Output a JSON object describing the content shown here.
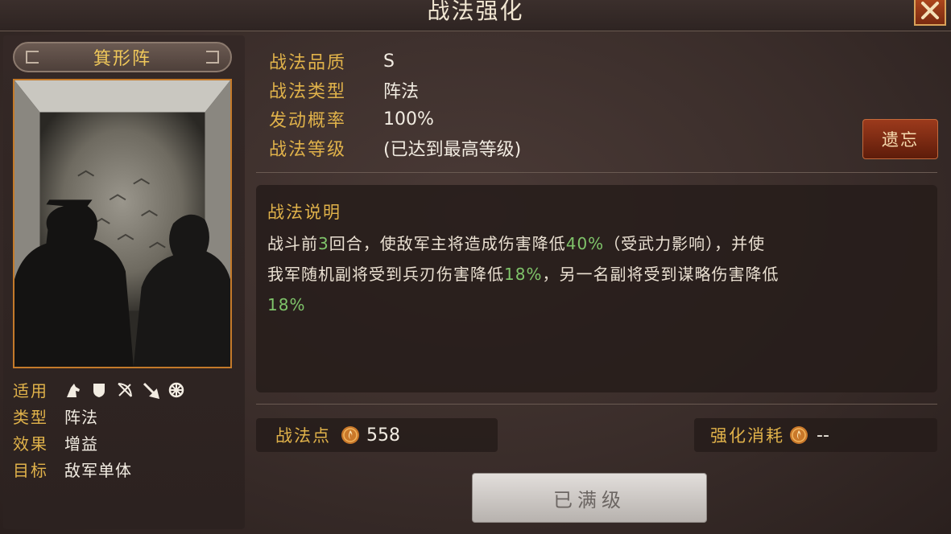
{
  "window": {
    "title": "战法强化"
  },
  "skill": {
    "name": "箕形阵",
    "attributes": {
      "applicable_label": "适用",
      "troop_icons": [
        "cavalry-icon",
        "shield-icon",
        "bow-icon",
        "spear-icon",
        "vehicle-icon"
      ],
      "type_label": "类型",
      "type_value": "阵法",
      "effect_label": "效果",
      "effect_value": "增益",
      "target_label": "目标",
      "target_value": "敌军单体"
    }
  },
  "info": {
    "quality_label": "战法品质",
    "quality_value": "S",
    "type_label": "战法类型",
    "type_value": "阵法",
    "rate_label": "发动概率",
    "rate_value": "100%",
    "level_label": "战法等级",
    "level_value": "(已达到最高等级)"
  },
  "forget_button": "遗忘",
  "description": {
    "title": "战法说明",
    "p1": "战斗前",
    "v1": "3",
    "p2": "回合，使敌军主将造成伤害降低",
    "v2": "40%",
    "p3": "（受武力影响），并使",
    "p4": "我军随机副将受到兵刃伤害降低",
    "v3": "18%",
    "p5": "，另一名副将受到谋略伤害降低",
    "v4": "18%"
  },
  "points": {
    "label": "战法点",
    "value": "558"
  },
  "cost": {
    "label": "强化消耗",
    "value": "--"
  },
  "max_button": "已满级",
  "colors": {
    "gold": "#e0b24a",
    "highlight": "#7fc46a",
    "accent_red": "#9c3a1c"
  }
}
